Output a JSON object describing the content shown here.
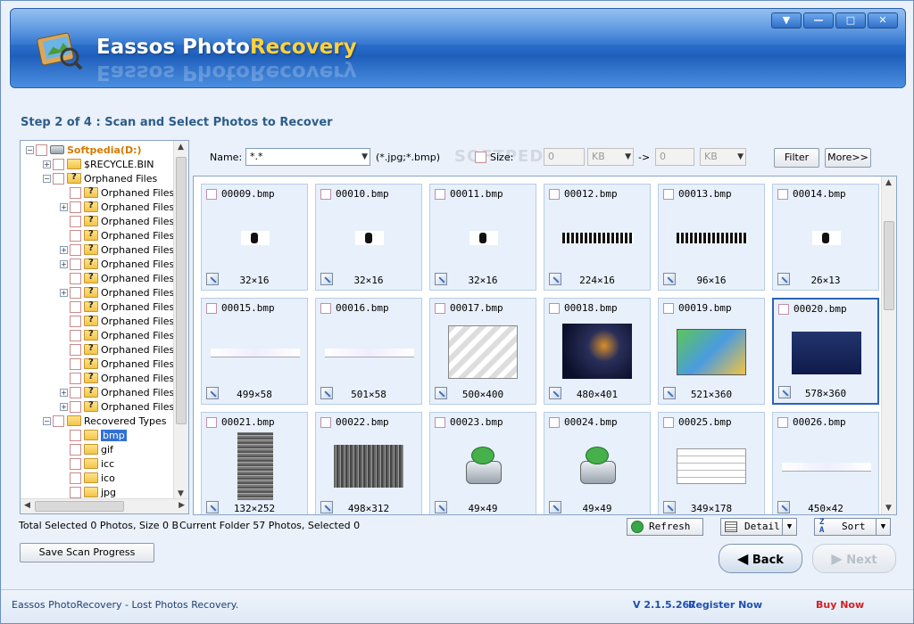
{
  "app": {
    "title_main": "Eassos Photo",
    "title_accent": "Recovery",
    "window_buttons": [
      "▼",
      "—",
      "□",
      "✕"
    ]
  },
  "step_title": "Step 2 of 4 : Scan and Select Photos to Recover",
  "tree": {
    "rows": [
      {
        "label": "Softpedia(D:)",
        "level": 0,
        "icon": "drive-icon",
        "pm": "−",
        "bold_orange": true
      },
      {
        "label": "$RECYCLE.BIN",
        "level": 1,
        "icon": "folder-icon",
        "pm": "+"
      },
      {
        "label": "Orphaned Files",
        "level": 1,
        "icon": "folder-question-icon",
        "pm": "−"
      },
      {
        "label": "Orphaned Files",
        "level": 2,
        "icon": "folder-question-icon",
        "pm": ""
      },
      {
        "label": "Orphaned Files",
        "level": 2,
        "icon": "folder-question-icon",
        "pm": "+"
      },
      {
        "label": "Orphaned Files",
        "level": 2,
        "icon": "folder-question-icon",
        "pm": ""
      },
      {
        "label": "Orphaned Files",
        "level": 2,
        "icon": "folder-question-icon",
        "pm": ""
      },
      {
        "label": "Orphaned Files",
        "level": 2,
        "icon": "folder-question-icon",
        "pm": "+"
      },
      {
        "label": "Orphaned Files",
        "level": 2,
        "icon": "folder-question-icon",
        "pm": "+"
      },
      {
        "label": "Orphaned Files",
        "level": 2,
        "icon": "folder-question-icon",
        "pm": ""
      },
      {
        "label": "Orphaned Files",
        "level": 2,
        "icon": "folder-question-icon",
        "pm": "+"
      },
      {
        "label": "Orphaned Files",
        "level": 2,
        "icon": "folder-question-icon",
        "pm": ""
      },
      {
        "label": "Orphaned Files",
        "level": 2,
        "icon": "folder-question-icon",
        "pm": ""
      },
      {
        "label": "Orphaned Files",
        "level": 2,
        "icon": "folder-question-icon",
        "pm": ""
      },
      {
        "label": "Orphaned Files",
        "level": 2,
        "icon": "folder-question-icon",
        "pm": ""
      },
      {
        "label": "Orphaned Files",
        "level": 2,
        "icon": "folder-question-icon",
        "pm": ""
      },
      {
        "label": "Orphaned Files",
        "level": 2,
        "icon": "folder-question-icon",
        "pm": ""
      },
      {
        "label": "Orphaned Files",
        "level": 2,
        "icon": "folder-question-icon",
        "pm": "+"
      },
      {
        "label": "Orphaned Files",
        "level": 2,
        "icon": "folder-question-icon",
        "pm": "+"
      },
      {
        "label": "Recovered Types",
        "level": 1,
        "icon": "folder-icon",
        "pm": "−"
      },
      {
        "label": "bmp",
        "level": 2,
        "icon": "folder-open-icon",
        "pm": "",
        "selected": true
      },
      {
        "label": "gif",
        "level": 2,
        "icon": "folder-icon",
        "pm": ""
      },
      {
        "label": "icc",
        "level": 2,
        "icon": "folder-icon",
        "pm": ""
      },
      {
        "label": "ico",
        "level": 2,
        "icon": "folder-icon",
        "pm": ""
      },
      {
        "label": "jpg",
        "level": 2,
        "icon": "folder-icon",
        "pm": ""
      }
    ]
  },
  "filter": {
    "name_label": "Name:",
    "name_value": "*.*",
    "name_hint": "(*.jpg;*.bmp)",
    "size_label": "Size:",
    "size_from": "0",
    "size_unit1": "KB",
    "arrow": "->",
    "size_to": "0",
    "size_unit2": "KB",
    "filter_button": "Filter",
    "more_button": "More>>",
    "watermark": "SOFTPEDIA"
  },
  "photos": [
    {
      "name": "00009.bmp",
      "dims": "32×16",
      "thumb": "tiny"
    },
    {
      "name": "00010.bmp",
      "dims": "32×16",
      "thumb": "tiny"
    },
    {
      "name": "00011.bmp",
      "dims": "32×16",
      "thumb": "tiny"
    },
    {
      "name": "00012.bmp",
      "dims": "224×16",
      "thumb": "strip"
    },
    {
      "name": "00013.bmp",
      "dims": "96×16",
      "thumb": "strip"
    },
    {
      "name": "00014.bmp",
      "dims": "26×13",
      "thumb": "tiny"
    },
    {
      "name": "00015.bmp",
      "dims": "499×58",
      "thumb": "banner"
    },
    {
      "name": "00016.bmp",
      "dims": "501×58",
      "thumb": "banner"
    },
    {
      "name": "00017.bmp",
      "dims": "500×400",
      "thumb": "screens"
    },
    {
      "name": "00018.bmp",
      "dims": "480×401",
      "thumb": "dark"
    },
    {
      "name": "00019.bmp",
      "dims": "521×360",
      "thumb": "colorful"
    },
    {
      "name": "00020.bmp",
      "dims": "578×360",
      "thumb": "blue",
      "selected": true
    },
    {
      "name": "00021.bmp",
      "dims": "132×252",
      "thumb": "noise-tall"
    },
    {
      "name": "00022.bmp",
      "dims": "498×312",
      "thumb": "noise"
    },
    {
      "name": "00023.bmp",
      "dims": "49×49",
      "thumb": "disk"
    },
    {
      "name": "00024.bmp",
      "dims": "49×49",
      "thumb": "disk"
    },
    {
      "name": "00025.bmp",
      "dims": "349×178",
      "thumb": "table"
    },
    {
      "name": "00026.bmp",
      "dims": "450×42",
      "thumb": "banner"
    }
  ],
  "status": {
    "total_selected": "Total Selected 0 Photos, Size 0 B",
    "current_folder": "Current Folder 57 Photos, Selected 0"
  },
  "toolbar": {
    "refresh": "Refresh",
    "detail": "Detail",
    "sort": "Sort",
    "save_scan": "Save Scan Progress",
    "back": "Back",
    "next": "Next"
  },
  "footer": {
    "tagline": "Eassos PhotoRecovery - Lost Photos Recovery.",
    "version": "V 2.1.5.267",
    "register": "Register Now",
    "buy": "Buy Now"
  },
  "colors": {
    "accent_blue": "#2d5d8a",
    "link_blue": "#1f4fb0",
    "buy_red": "#d42020"
  }
}
